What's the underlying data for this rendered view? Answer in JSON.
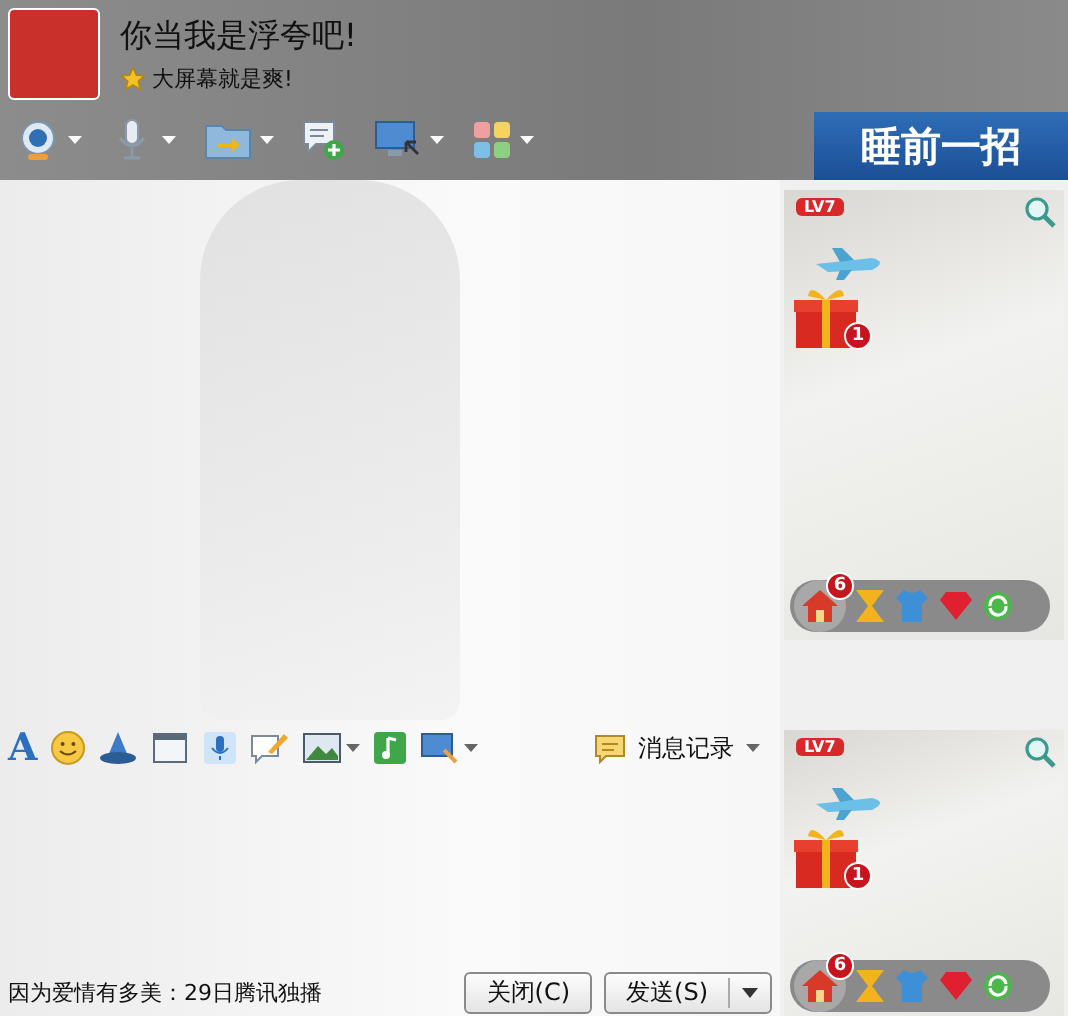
{
  "contact": {
    "name": "你当我是浮夸吧!",
    "signature": "大屏幕就是爽!"
  },
  "toolbar": [
    {
      "kind": "webcam",
      "dropdown": true
    },
    {
      "kind": "mic",
      "dropdown": true
    },
    {
      "kind": "folder",
      "dropdown": true
    },
    {
      "kind": "chat-add",
      "dropdown": false
    },
    {
      "kind": "screen",
      "dropdown": true
    },
    {
      "kind": "apps",
      "dropdown": true
    }
  ],
  "banner": {
    "text": "睡前一招"
  },
  "show_panels": [
    {
      "level_badge": "LV7",
      "gift_count": "1",
      "home_count": "6"
    },
    {
      "level_badge": "LV7",
      "gift_count": "1",
      "home_count": "6"
    }
  ],
  "input_toolbar": {
    "tools": [
      {
        "kind": "font",
        "glyph": "A",
        "dropdown": false
      },
      {
        "kind": "smiley",
        "dropdown": false
      },
      {
        "kind": "hat",
        "dropdown": false
      },
      {
        "kind": "window",
        "dropdown": false
      },
      {
        "kind": "mic",
        "dropdown": false
      },
      {
        "kind": "note",
        "dropdown": false
      },
      {
        "kind": "image",
        "dropdown": true
      },
      {
        "kind": "music",
        "dropdown": false
      },
      {
        "kind": "screenshot",
        "dropdown": true
      }
    ],
    "history_label": "消息记录"
  },
  "status_text": "因为爱情有多美：29日腾讯独播",
  "buttons": [
    {
      "label": "关闭(C)",
      "kind": "plain"
    },
    {
      "label": "发送(S)",
      "kind": "split"
    }
  ]
}
